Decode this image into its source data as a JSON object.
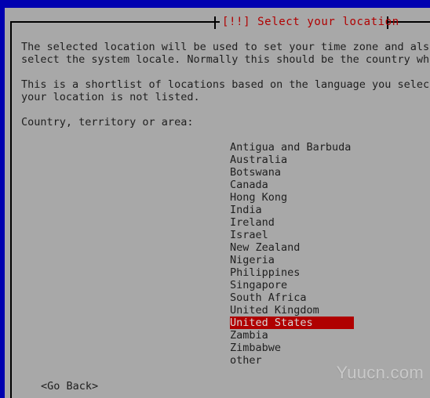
{
  "window": {
    "title": "[!!] Select your location",
    "title_color": "#b00000",
    "background_color": "#a8a8a8",
    "desktop_color": "#0000b0",
    "text_color": "#202020"
  },
  "body": {
    "paragraph1": "The selected location will be used to set your time zone and also\nselect the system locale. Normally this should be the country wher",
    "paragraph2": "This is a shortlist of locations based on the language you selecte\nyour location is not listed.",
    "list_label": "Country, territory or area:"
  },
  "country_list": {
    "selected": "United States",
    "selected_bg": "#b00000",
    "selected_fg": "#d8d8d8",
    "items": [
      "Antigua and Barbuda",
      "Australia",
      "Botswana",
      "Canada",
      "Hong Kong",
      "India",
      "Ireland",
      "Israel",
      "New Zealand",
      "Nigeria",
      "Philippines",
      "Singapore",
      "South Africa",
      "United Kingdom",
      "United States",
      "Zambia",
      "Zimbabwe",
      "other"
    ]
  },
  "buttons": {
    "go_back": "<Go Back>"
  },
  "watermark": {
    "text": "Yuucn.com"
  }
}
